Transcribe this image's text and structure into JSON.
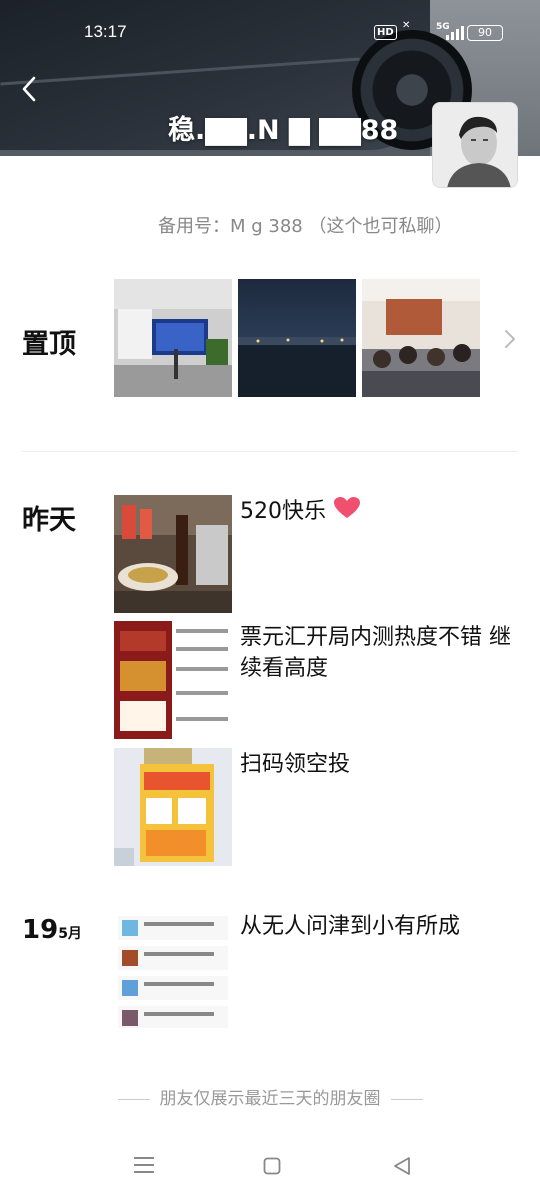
{
  "status_bar": {
    "time": "13:17",
    "network": "5G",
    "battery": "90"
  },
  "profile": {
    "name": "稳.▇▇.N  ▇ ▇▇88",
    "alt_account": "备用号：M      g   388 （这个也可私聊）"
  },
  "pinned": {
    "label": "置顶"
  },
  "yesterday": {
    "label": "昨天"
  },
  "posts": [
    {
      "text": "520快乐"
    },
    {
      "text": "票元汇开局内测热度不错 继续看高度"
    },
    {
      "text": "扫码领空投"
    },
    {
      "text": "从无人问津到小有所成"
    }
  ],
  "date_group": {
    "day": "19",
    "month": "5月"
  },
  "footer": {
    "text": "朋友仅展示最近三天的朋友圈"
  },
  "colors": {
    "heart": "#f0506e",
    "accent_gold": "#f5c33b",
    "poster_red": "#8b1a1a"
  },
  "icons": {
    "back": "chevron-left",
    "more": "chevron-right",
    "menu": "menu-icon",
    "home": "square-icon",
    "nav_back": "triangle-icon"
  }
}
